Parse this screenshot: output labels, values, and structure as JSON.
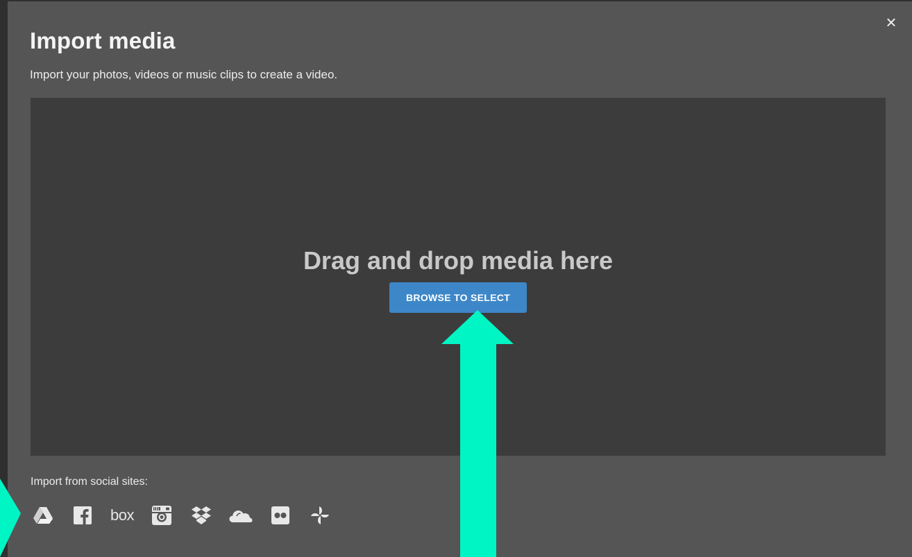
{
  "dialog": {
    "title": "Import media",
    "subtitle": "Import your photos, videos or music clips to create a video.",
    "close_glyph": "×"
  },
  "dropzone": {
    "message": "Drag and drop media here",
    "button_label": "BROWSE TO SELECT"
  },
  "social": {
    "label": "Import from social sites:",
    "providers": [
      {
        "name": "Google Drive",
        "icon": "google-drive-icon"
      },
      {
        "name": "Facebook",
        "icon": "facebook-icon"
      },
      {
        "name": "Box",
        "icon": "box-icon",
        "text": "box"
      },
      {
        "name": "Instagram",
        "icon": "instagram-icon"
      },
      {
        "name": "Dropbox",
        "icon": "dropbox-icon"
      },
      {
        "name": "OneDrive",
        "icon": "onedrive-icon"
      },
      {
        "name": "Flickr",
        "icon": "flickr-icon"
      },
      {
        "name": "Google Photos",
        "icon": "google-photos-icon"
      }
    ]
  },
  "colors": {
    "modal_bg": "#555555",
    "dropzone_bg": "#3c3c3c",
    "button_bg": "#3d87c9",
    "annotation_arrow": "#00f5c4"
  }
}
